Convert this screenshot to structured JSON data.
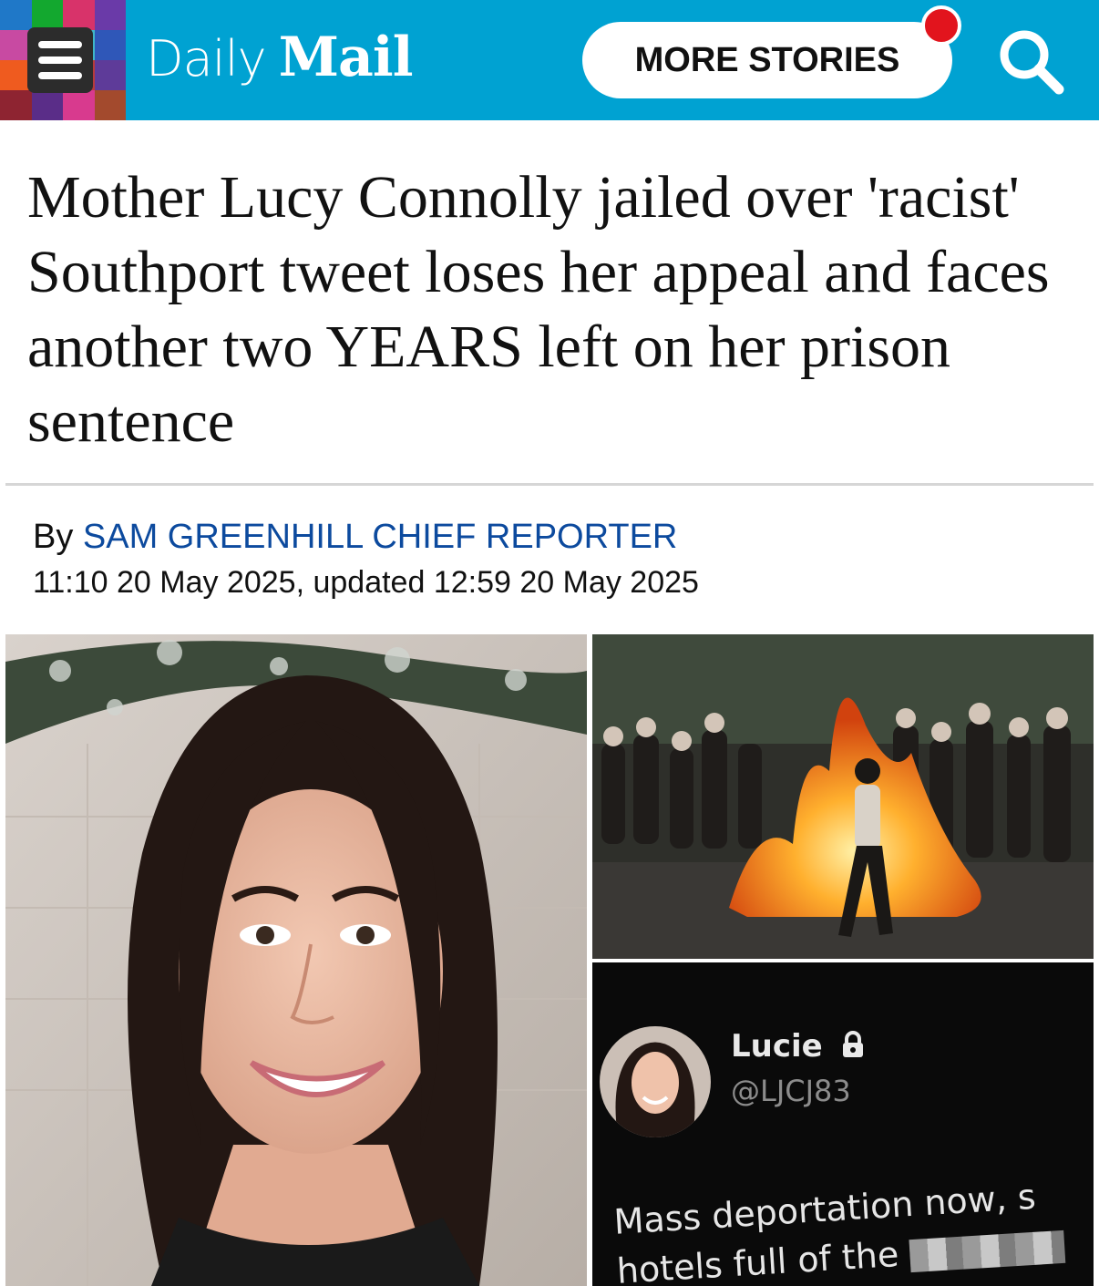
{
  "header": {
    "logo_daily": "Daily",
    "logo_mail": "Mail",
    "more_stories_label": "MORE STORIES",
    "menu_icon": "hamburger-menu-icon",
    "search_icon": "search-icon",
    "brand_color": "#00a2d2",
    "notification_color": "#e2141d"
  },
  "article": {
    "headline": "Mother Lucy Connolly jailed over 'racist' Southport tweet loses her appeal and faces another two YEARS left on her prison sentence",
    "byline_prefix": "By ",
    "author": "SAM GREENHILL CHIEF REPORTER",
    "dateline": "11:10 20 May 2025, updated 12:59 20 May 2025",
    "author_color": "#0c4a9e"
  },
  "images": {
    "tweet": {
      "name": "Lucie",
      "handle": "@LJCJ83",
      "line1": "Mass deportation now, s",
      "line2_prefix": "hotels full of the",
      "lock_icon": "lock-icon"
    }
  }
}
